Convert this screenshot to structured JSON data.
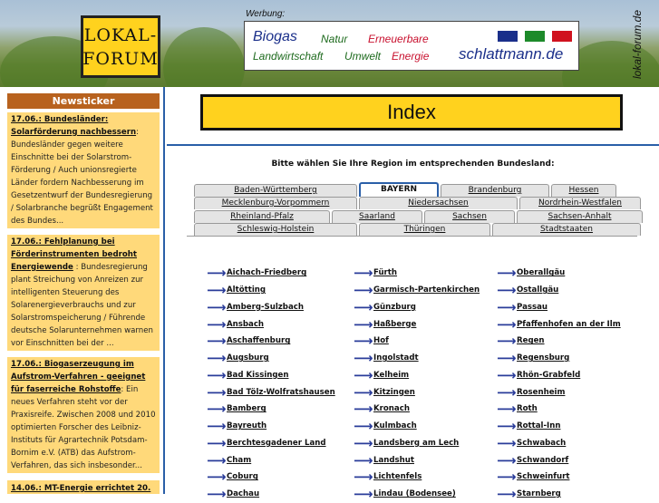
{
  "header": {
    "logo_line1": "LOKAL-",
    "logo_line2": "FORUM",
    "ad_label": "Werbung:",
    "ad_words": [
      {
        "text": "Biogas",
        "color": "#1a2f8a"
      },
      {
        "text": "Natur",
        "color": "#1d6a1d"
      },
      {
        "text": "Erneuerbare",
        "color": "#c8102e"
      },
      {
        "text": "Landwirtschaft",
        "color": "#1d6a1d"
      },
      {
        "text": "Umwelt",
        "color": "#1d6a1d"
      },
      {
        "text": "Energie",
        "color": "#c8102e"
      }
    ],
    "ad_site": "schlattmann.de",
    "ad_flags": [
      "#1a2f8a",
      "#1d8a2a",
      "#d0121e"
    ],
    "vertical_url": "lokal-forum.de"
  },
  "sidebar": {
    "title": "Newsticker",
    "items": [
      {
        "headline": "17.06.: Bundesländer: Solarförderung nachbessern",
        "text": ": Bundesländer gegen weitere Einschnitte bei der Solarstrom-Förderung / Auch unionsregierte Länder fordern Nachbesserung im Gesetzentwurf der Bundesregierung / Solarbranche begrüßt Engagement des Bundes..."
      },
      {
        "headline": "17.06.: Fehlplanung bei Förderinstrumenten bedroht Energiewende",
        "text": " : Bundesregierung plant Streichung von Anreizen zur intelligenten Steuerung des Solarenergieverbrauchs und zur Solarstromspeicherung / Führende deutsche Solarunternehmen warnen vor Einschnitten bei der ..."
      },
      {
        "headline": "17.06.: Biogaserzeugung im Aufstrom-Verfahren - geeignet für faserreiche Rohstoffe",
        "text": ": Ein neues Verfahren steht vor der Praxisreife. Zwischen 2008 und 2010 optimierten Forscher des Leibniz-Instituts für Agrartechnik Potsdam-Bornim e.V. (ATB) das Aufstrom-Verfahren, das sich insbesonder..."
      },
      {
        "headline": "14.06.: MT-Energie errichtet 20."
      }
    ]
  },
  "main": {
    "title": "Index",
    "prompt": "Bitte wählen Sie Ihre Region im entsprechenden Bundesland:",
    "tab_rows": [
      [
        {
          "label": "Baden-Württemberg"
        },
        {
          "label": "BAYERN",
          "active": true
        },
        {
          "label": "Brandenburg"
        },
        {
          "label": "Hessen"
        }
      ],
      [
        {
          "label": "Mecklenburg-Vorpommern"
        },
        {
          "label": "Niedersachsen"
        },
        {
          "label": "Nordrhein-Westfalen"
        }
      ],
      [
        {
          "label": "Rheinland-Pfalz"
        },
        {
          "label": "Saarland"
        },
        {
          "label": "Sachsen"
        },
        {
          "label": "Sachsen-Anhalt"
        }
      ],
      [
        {
          "label": "Schleswig-Holstein"
        },
        {
          "label": "Thüringen"
        },
        {
          "label": "Stadtstaaten"
        }
      ]
    ],
    "arrow_glyph": "⟶",
    "regions": [
      [
        "Aichach-Friedberg",
        "Altötting",
        "Amberg-Sulzbach",
        "Ansbach",
        "Aschaffenburg",
        "Augsburg",
        "Bad Kissingen",
        "Bad Tölz-Wolfratshausen",
        "Bamberg",
        "Bayreuth",
        "Berchtesgadener Land",
        "Cham",
        "Coburg",
        "Dachau"
      ],
      [
        "Fürth",
        "Garmisch-Partenkirchen",
        "Günzburg",
        "Haßberge",
        "Hof",
        "Ingolstadt",
        "Kelheim",
        "Kitzingen",
        "Kronach",
        "Kulmbach",
        "Landsberg am Lech",
        "Landshut",
        "Lichtenfels",
        "Lindau (Bodensee)"
      ],
      [
        "Oberallgäu",
        "Ostallgäu",
        "Passau",
        "Pfaffenhofen an der Ilm",
        "Regen",
        "Regensburg",
        "Rhön-Grabfeld",
        "Rosenheim",
        "Roth",
        "Rottal-Inn",
        "Schwabach",
        "Schwandorf",
        "Schweinfurt",
        "Starnberg"
      ]
    ]
  }
}
